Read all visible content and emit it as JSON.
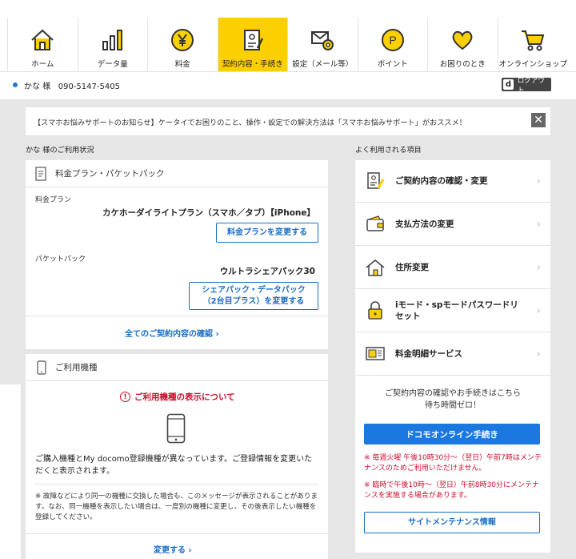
{
  "nav": {
    "items": [
      {
        "label": "ホーム",
        "icon": "home-icon"
      },
      {
        "label": "データ量",
        "icon": "bar-chart-icon"
      },
      {
        "label": "料金",
        "icon": "yen-icon"
      },
      {
        "label": "契約内容・手続き",
        "icon": "contract-icon",
        "active": true
      },
      {
        "label": "設定（メール等）",
        "icon": "mail-settings-icon"
      },
      {
        "label": "ポイント",
        "icon": "points-icon"
      },
      {
        "label": "お困りのとき",
        "icon": "heart-icon"
      },
      {
        "label": "オンラインショップ",
        "icon": "cart-icon"
      }
    ]
  },
  "user": {
    "name": "かな 様",
    "phone": "090-5147-5405",
    "logout_label": "ログアウト",
    "logout_badge": "d"
  },
  "notice": {
    "text": "【スマホお悩みサポートのお知らせ】ケータイでお困りのこと、操作・設定での解決方法は「スマホお悩みサポート」がおススメ！",
    "close": "✕"
  },
  "usage": {
    "title": "かな 様のご利用状況",
    "plan_card": {
      "title": "料金プラン・パケットパック",
      "plan_label": "料金プラン",
      "plan_value": "カケホーダイライトプラン（スマホ／タブ）【iPhone】",
      "plan_button": "料金プランを変更する",
      "packet_label": "パケットパック",
      "packet_value": "ウルトラシェアパック30",
      "packet_button_line1": "シェアパック・データパック",
      "packet_button_line2": "（2台目プラス）を変更する",
      "all_link": "全てのご契約内容の確認 ›"
    },
    "device_card": {
      "title": "ご利用機種",
      "warning": "ご利用機種の表示について",
      "warning_mark": "!",
      "message": "ご購入機種とMy docomo登録機種が異なっています。ご登録情報を変更いただくと表示されます。",
      "note": "※ 故障などにより同一の機種に交換した場合も、このメッセージが表示されることがあります。なお、同一機種を表示したい場合は、一度別の機種に変更し、その後表示したい機種を登録してください。",
      "change_link": "変更する ›"
    }
  },
  "frequent": {
    "title": "よく利用される項目",
    "items": [
      {
        "label": "ご契約内容の確認・変更",
        "icon": "contract-edit-icon"
      },
      {
        "label": "支払方法の変更",
        "icon": "wallet-icon"
      },
      {
        "label": "住所変更",
        "icon": "house-icon"
      },
      {
        "label": "iモード・spモードパスワードリセット",
        "icon": "lock-reset-icon"
      },
      {
        "label": "料金明細サービス",
        "icon": "statement-icon"
      }
    ],
    "chevron": "›",
    "online_text_line1": "ご契約内容の確認やお手続きはこちら",
    "online_text_line2": "待ち時間ゼロ！",
    "online_button": "ドコモオンライン手続き",
    "maintenance_note1": "※ 毎週火曜 午後10時30分～（翌日）午前7時はメンテナンスのためご利用いただけません。",
    "maintenance_note2": "※ 臨時で午後10時～（翌日）午前8時30分にメンテナンスを実施する場合があります。",
    "maintenance_button": "サイトメンテナンス情報"
  },
  "colors": {
    "accent": "#fcd000",
    "link": "#1a6fc4",
    "primary_button": "#1a78e0",
    "alert": "#c8102e",
    "background": "#e6e6e6"
  }
}
